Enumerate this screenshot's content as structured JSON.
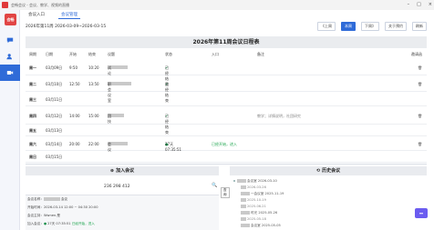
{
  "titlebar": {
    "title": "会畅会议 - 会议、教学、视频的直播"
  },
  "rail": {
    "brand": "会畅"
  },
  "tabs": [
    {
      "label": "会议入口",
      "active": false
    },
    {
      "label": "会议管理",
      "active": true
    }
  ],
  "rangebar": {
    "range_text": "2026年第11周 2026-03-09~2026-03-15",
    "prev": "《上周",
    "this": "本周",
    "next": "下周》",
    "reserve": "关于预约",
    "refresh": "刷新"
  },
  "schedule": {
    "title": "2026年第11周会议日程表",
    "columns": [
      "周期",
      "日期",
      "开始",
      "结束",
      "议题",
      "状态",
      "入口",
      "备注",
      "邀请函"
    ],
    "rows": [
      {
        "day": "周一",
        "date": "03月09日",
        "start": "9:50",
        "end": "10:20",
        "topic": "试论",
        "status": "已经结束",
        "entry": "",
        "note": ""
      },
      {
        "day": "周二",
        "date": "03月10日",
        "start": "12:50",
        "end": "13:50",
        "topic": "职会议室",
        "status": "已经结束",
        "entry": "",
        "note": ""
      },
      {
        "day": "周三",
        "date": "03月11日",
        "start": "",
        "end": "",
        "topic": "",
        "status": "",
        "entry": "",
        "note": ""
      },
      {
        "day": "周四",
        "date": "03月12日",
        "start": "14:00",
        "end": "15:00",
        "topic": "团技",
        "status": "已经结束",
        "entry": "",
        "note": "教学；详情说明，社团研究"
      },
      {
        "day": "周五",
        "date": "03月13日",
        "start": "",
        "end": "",
        "topic": "",
        "status": "",
        "entry": "",
        "note": ""
      },
      {
        "day": "周六",
        "date": "03月14日",
        "start": "20:00",
        "end": "22:00",
        "topic": "会议",
        "status": "27天 07:35:51",
        "entry": "已经开始，进入",
        "note": ""
      },
      {
        "day": "周日",
        "date": "03月15日",
        "start": "",
        "end": "",
        "topic": "",
        "status": "",
        "entry": "",
        "note": ""
      }
    ]
  },
  "join": {
    "title": "加入会议",
    "meeting_id": "236 298 412",
    "search_tooltip": "查询",
    "info": {
      "name_label": "会议名称：",
      "name": "会议",
      "time_label": "开始时间：",
      "time": "2026-03-14 12:00 ~ 04:30 20:00",
      "host_label": "会议主持：",
      "host": "Wwnen.是",
      "entry_label": "加入会议：",
      "entry": "27天 07:35:51",
      "entry_status": "已经开始，进入"
    }
  },
  "history": {
    "title": "历史会议",
    "items": [
      {
        "title": "会议室 2026-03-10",
        "sub": false
      },
      {
        "title": "2026-03-26",
        "sub": true
      },
      {
        "title": "一会议室 2025-11-19",
        "sub": false
      },
      {
        "title": "2025-10-19",
        "sub": true
      },
      {
        "title": "2025-06-21",
        "sub": true
      },
      {
        "title": "时光 2025-05-26",
        "sub": false
      },
      {
        "title": "2025-05-18",
        "sub": true
      },
      {
        "title": "会议室 2025-05-05",
        "sub": false
      }
    ]
  },
  "float_button": {
    "label": "▾▾"
  },
  "colors": {
    "accent": "#2f6bd8",
    "brand": "#e14545",
    "success": "#18a34a",
    "float": "#6b5cf0"
  }
}
